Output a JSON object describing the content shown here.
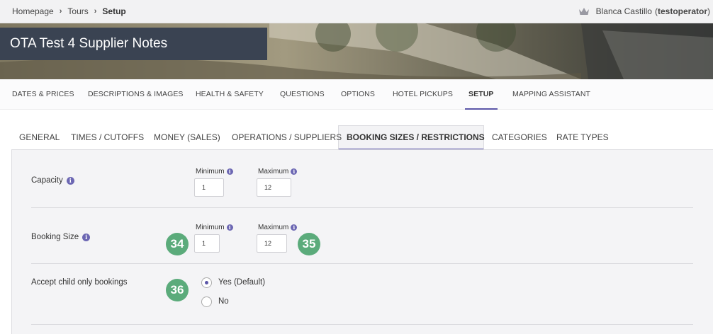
{
  "breadcrumb": {
    "items": [
      "Homepage",
      "Tours",
      "Setup"
    ]
  },
  "user": {
    "name": "Blanca Castillo",
    "username": "testoperator",
    "icon": "crown-icon"
  },
  "banner": {
    "title": "OTA Test 4 Supplier Notes"
  },
  "main_tabs": [
    {
      "label": "DATES & PRICES"
    },
    {
      "label": "DESCRIPTIONS & IMAGES"
    },
    {
      "label": "HEALTH & SAFETY"
    },
    {
      "label": "QUESTIONS"
    },
    {
      "label": "OPTIONS"
    },
    {
      "label": "HOTEL PICKUPS"
    },
    {
      "label": "SETUP"
    },
    {
      "label": "MAPPING ASSISTANT"
    }
  ],
  "sub_tabs": [
    {
      "label": "GENERAL"
    },
    {
      "label": "TIMES / CUTOFFS"
    },
    {
      "label": "MONEY (SALES)"
    },
    {
      "label": "OPERATIONS / SUPPLIERS"
    },
    {
      "label": "BOOKING SIZES / RESTRICTIONS"
    },
    {
      "label": "CATEGORIES"
    },
    {
      "label": "RATE TYPES"
    }
  ],
  "capacity": {
    "label": "Capacity",
    "min_label": "Minimum",
    "max_label": "Maximum",
    "min_value": "1",
    "max_value": "12"
  },
  "booking_size": {
    "label": "Booking Size",
    "min_label": "Minimum",
    "max_label": "Maximum",
    "min_value": "1",
    "max_value": "12"
  },
  "child_only": {
    "label": "Accept child only bookings",
    "options": [
      "Yes (Default)",
      "No"
    ],
    "selected": "Yes (Default)"
  },
  "badges": [
    "34",
    "35",
    "36"
  ],
  "colors": {
    "accent": "#5b56a8",
    "badge": "#5bab7b",
    "title_bg": "#3a4352",
    "info": "#6c67b3"
  }
}
